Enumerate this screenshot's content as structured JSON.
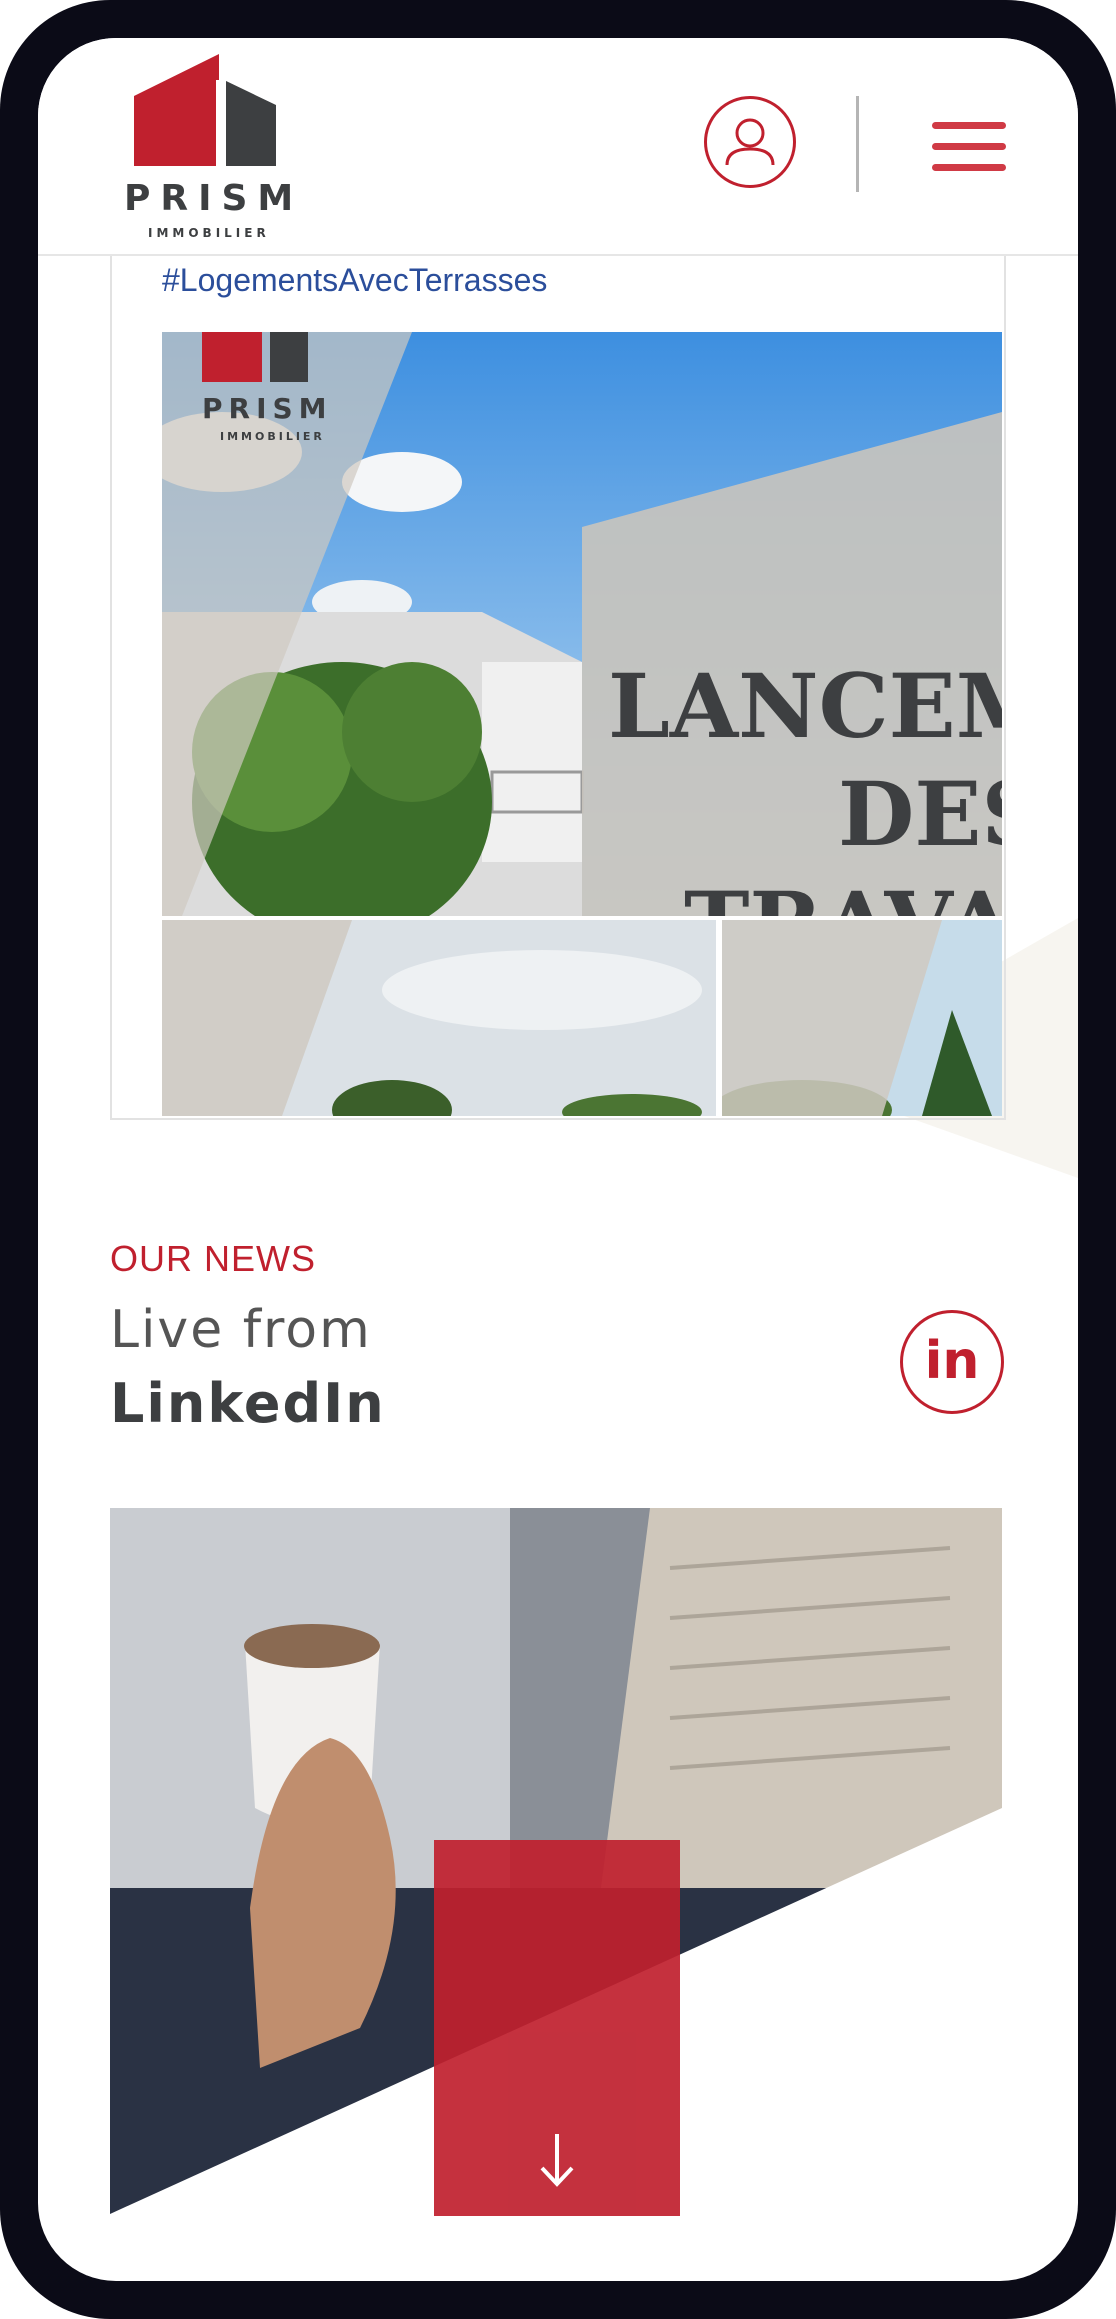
{
  "header": {
    "logo_text": "PRISM",
    "logo_subtext": "IMMOBILIER",
    "account_icon": "user-circle-icon",
    "menu_icon": "hamburger-menu-icon"
  },
  "post": {
    "hashtag": "#LogementsAvecTerrasses",
    "image_logo_text": "PRISM",
    "image_logo_subtext": "IMMOBILIER",
    "image_headline_lines": [
      "LANCEM",
      "DES",
      "TRAVA"
    ]
  },
  "news": {
    "kicker": "OUR NEWS",
    "title_line1": "Live from",
    "title_line2": "LinkedIn",
    "linkedin_icon": "linkedin-icon",
    "linkedin_glyph": "in"
  },
  "scroll_button": {
    "icon": "arrow-down-icon"
  },
  "colors": {
    "brand_red": "#c0202e",
    "brand_gray": "#3d3f41",
    "hashtag_blue": "#2b4e9b"
  }
}
